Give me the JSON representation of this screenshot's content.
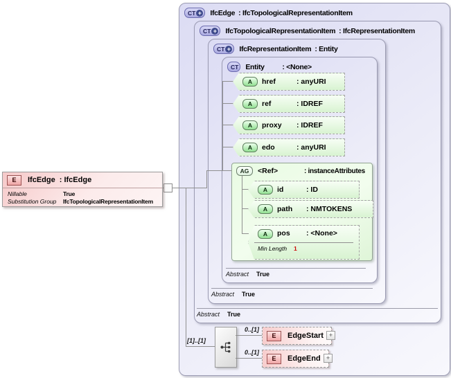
{
  "element_box": {
    "badge": "E",
    "name": "IfcEdge",
    "type": ": IfcEdge",
    "rows": [
      {
        "label": "Nillable",
        "value": "True"
      },
      {
        "label": "Substitution Group",
        "value": "IfcTopologicalRepresentationItem"
      }
    ]
  },
  "containers": {
    "outer": {
      "badge": "CT",
      "plus": "+",
      "name": "IfcEdge",
      "type": ": IfcTopologicalRepresentationItem"
    },
    "level2": {
      "badge": "CT",
      "plus": "+",
      "name": "IfcTopologicalRepresentationItem",
      "type": ": IfcRepresentationItem",
      "abstract_label": "Abstract",
      "abstract_value": "True"
    },
    "level3": {
      "badge": "CT",
      "plus": "+",
      "name": "IfcRepresentationItem",
      "type": ": Entity",
      "abstract_label": "Abstract",
      "abstract_value": "True"
    },
    "entity": {
      "badge": "CT",
      "name": "Entity",
      "type": ": <None>",
      "abstract_label": "Abstract",
      "abstract_value": "True"
    }
  },
  "attributes": [
    {
      "badge": "A",
      "name": "href",
      "type": ": anyURI"
    },
    {
      "badge": "A",
      "name": "ref",
      "type": ": IDREF"
    },
    {
      "badge": "A",
      "name": "proxy",
      "type": ": IDREF"
    },
    {
      "badge": "A",
      "name": "edo",
      "type": ": anyURI"
    }
  ],
  "attribute_group": {
    "badge": "AG",
    "name": "<Ref>",
    "type": ": instanceAttributes",
    "attributes": [
      {
        "badge": "A",
        "name": "id",
        "type": ": ID"
      },
      {
        "badge": "A",
        "name": "path",
        "type": ": NMTOKENS"
      },
      {
        "badge": "A",
        "name": "pos",
        "type": ": <None>",
        "facet_label": "Min Length",
        "facet_value": "1"
      }
    ]
  },
  "sequence": {
    "cardinality": "[1]..[1]",
    "children": [
      {
        "cardinality": "0..[1]",
        "badge": "E",
        "name": "EdgeStart",
        "expand": "+"
      },
      {
        "cardinality": "0..[1]",
        "badge": "E",
        "name": "EdgeEnd",
        "expand": "+"
      }
    ]
  },
  "colors": {
    "container_fill": "#e4e4f6",
    "container_border": "#9a9ab1",
    "attribute_fill": "#e2f7da",
    "attribute_badge": "#92e092",
    "element_fill": "#f6c9c9",
    "ct_badge_fill": "#b4b4e6",
    "facet_value_color": "#cc0000",
    "line_color": "#8f8f8f"
  }
}
